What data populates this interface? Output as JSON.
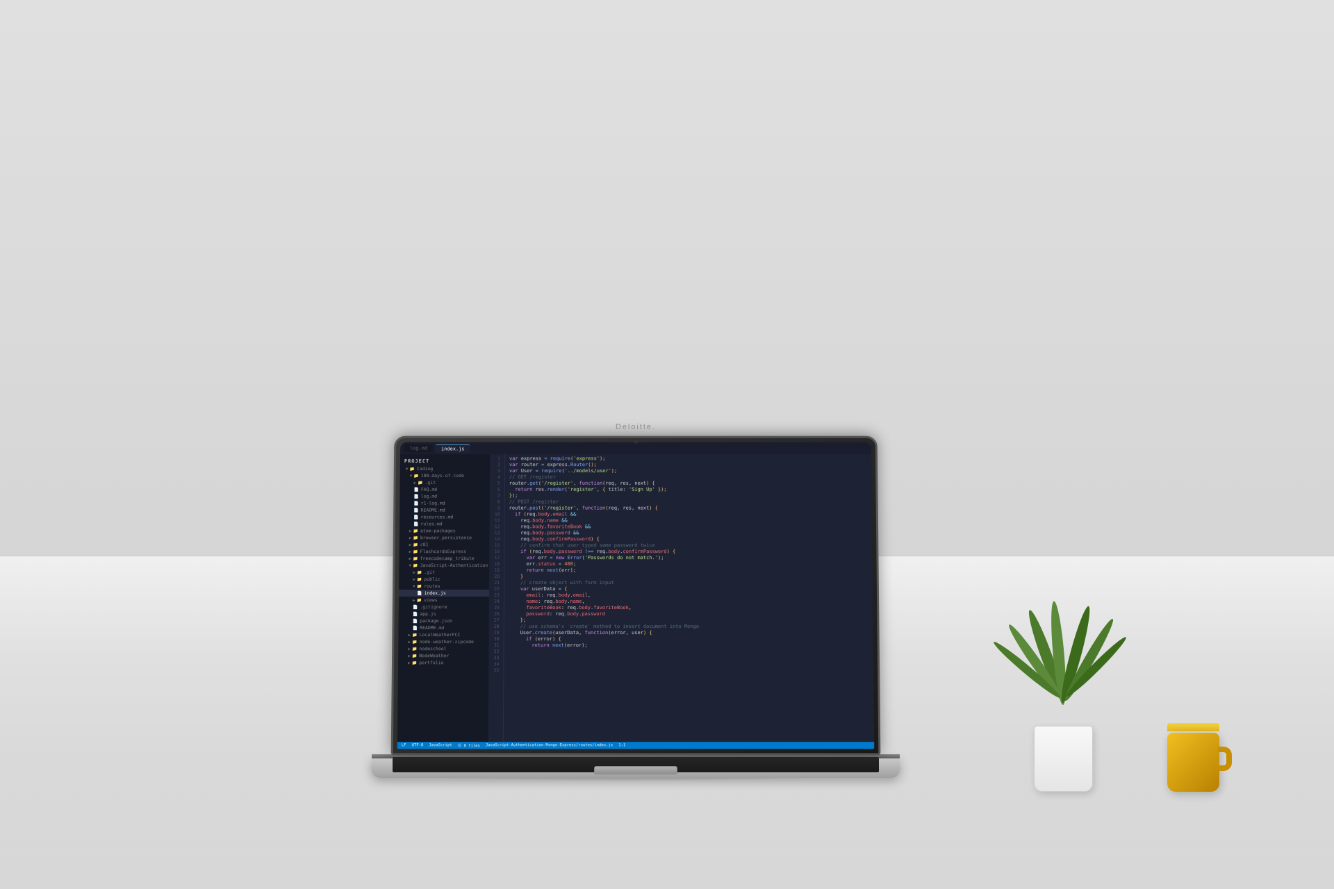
{
  "scene": {
    "brand": "Deloitte.",
    "laptop_label": "laptop-with-code-editor",
    "editor": {
      "tabs": [
        {
          "label": "log.md",
          "active": false
        },
        {
          "label": "index.js",
          "active": true
        }
      ],
      "sidebar_title": "Project",
      "sidebar_items": [
        {
          "label": "Coding",
          "indent": 0,
          "expanded": true,
          "icon": "folder"
        },
        {
          "label": "100-days-of-code",
          "indent": 1,
          "expanded": true,
          "icon": "folder"
        },
        {
          "label": ".git",
          "indent": 2,
          "icon": "folder"
        },
        {
          "label": "FAQ.md",
          "indent": 2,
          "icon": "file"
        },
        {
          "label": "log.md",
          "indent": 2,
          "icon": "file"
        },
        {
          "label": "r1-log.md",
          "indent": 2,
          "icon": "file"
        },
        {
          "label": "README.md",
          "indent": 2,
          "icon": "file"
        },
        {
          "label": "resources.md",
          "indent": 2,
          "icon": "file"
        },
        {
          "label": "rules.md",
          "indent": 2,
          "icon": "file"
        },
        {
          "label": "atom-packages",
          "indent": 1,
          "icon": "folder"
        },
        {
          "label": "browser_persistence",
          "indent": 1,
          "icon": "folder"
        },
        {
          "label": "c01",
          "indent": 1,
          "icon": "folder"
        },
        {
          "label": "FlashcardsExpress",
          "indent": 1,
          "icon": "folder"
        },
        {
          "label": "freecodecamp_tribute",
          "indent": 1,
          "icon": "folder"
        },
        {
          "label": "JavaScript-Authentication",
          "indent": 1,
          "expanded": true,
          "icon": "folder"
        },
        {
          "label": ".git",
          "indent": 2,
          "icon": "folder"
        },
        {
          "label": "public",
          "indent": 2,
          "icon": "folder"
        },
        {
          "label": "routes",
          "indent": 2,
          "expanded": true,
          "icon": "folder"
        },
        {
          "label": "index.js",
          "indent": 3,
          "icon": "file",
          "active": true
        },
        {
          "label": "views",
          "indent": 2,
          "icon": "folder"
        },
        {
          "label": ".gitignore",
          "indent": 2,
          "icon": "file"
        },
        {
          "label": "app.js",
          "indent": 2,
          "icon": "file"
        },
        {
          "label": "package.json",
          "indent": 2,
          "icon": "file"
        },
        {
          "label": "README.md",
          "indent": 2,
          "icon": "file"
        },
        {
          "label": "LocalWeatherFCC",
          "indent": 1,
          "icon": "folder"
        },
        {
          "label": "node-weather-zipcode",
          "indent": 1,
          "icon": "folder"
        },
        {
          "label": "nodeschool",
          "indent": 1,
          "icon": "folder"
        },
        {
          "label": "NodeWeather",
          "indent": 1,
          "icon": "folder"
        },
        {
          "label": "portfolio",
          "indent": 1,
          "icon": "folder"
        }
      ],
      "status_bar": {
        "branch": "LF",
        "encoding": "UTF-8",
        "language": "JavaScript",
        "errors": "⓪ 0 files"
      },
      "filepath": "JavaScript-Authentication-Mongo-Express/routes/index.js",
      "cursor_pos": "1:1"
    },
    "plant": {
      "label": "decorative-plant"
    },
    "mug": {
      "label": "yellow-mug"
    }
  }
}
